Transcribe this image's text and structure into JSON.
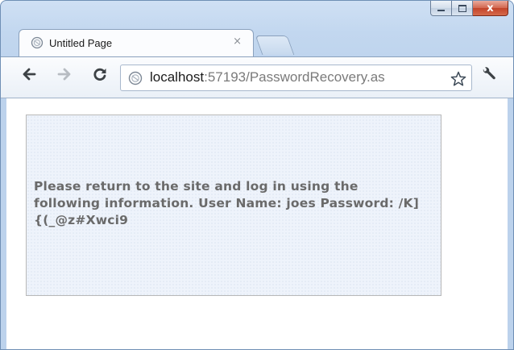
{
  "tab": {
    "title": "Untitled Page",
    "close_glyph": "×",
    "favicon": "globe-icon"
  },
  "window_controls": {
    "minimize": "minimize-icon",
    "maximize": "maximize-icon",
    "close_glyph": "x"
  },
  "toolbar": {
    "back": "back-arrow-icon",
    "forward": "forward-arrow-icon",
    "reload": "reload-icon",
    "bookmark": "star-icon",
    "menu": "wrench-icon"
  },
  "address_bar": {
    "host": "localhost",
    "rest": ":57193/PasswordRecovery.as"
  },
  "page": {
    "message": "Please return to the site and log in using the following information. User Name: joes Password: /K]{(_@z#Xwci9"
  },
  "colors": {
    "frame": "#c2d7ef",
    "close_button": "#c2432a",
    "box_background": "#eef3fb",
    "message_text": "#6a6a6a"
  }
}
